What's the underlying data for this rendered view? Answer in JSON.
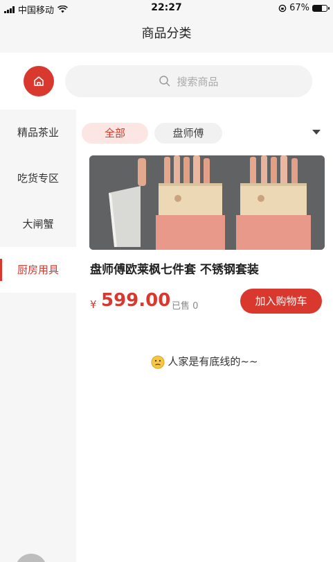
{
  "status_bar": {
    "carrier": "中国移动",
    "time": "22:27",
    "battery": "67%",
    "battery_level": 0.67
  },
  "header": {
    "title": "商品分类"
  },
  "search": {
    "placeholder": "搜索商品"
  },
  "sidebar": {
    "items": [
      {
        "label": "精品茶业"
      },
      {
        "label": "吃货专区"
      },
      {
        "label": "大闸蟹"
      },
      {
        "label": "厨房用具"
      }
    ],
    "active_index": 3
  },
  "filters": {
    "chips": [
      {
        "label": "全部"
      },
      {
        "label": "盘师傅"
      }
    ]
  },
  "product": {
    "name": "盘师傅欧莱枫七件套 不锈钢套装",
    "currency": "¥",
    "price": "599.00",
    "sold": "已售 0",
    "add_to_cart": "加入购物车"
  },
  "end_note": "人家是有底线的~~",
  "colors": {
    "accent": "#d9382e",
    "accent_light": "#fbe6e3"
  }
}
